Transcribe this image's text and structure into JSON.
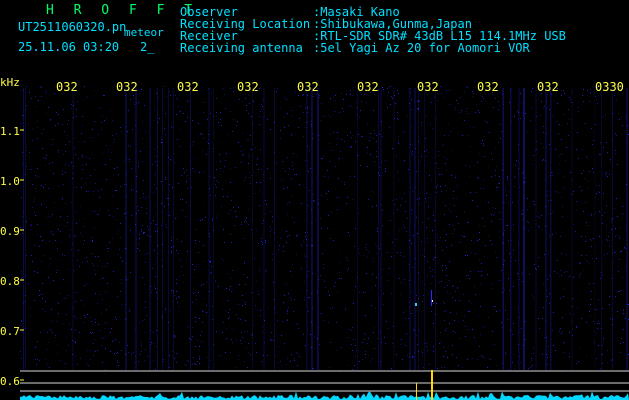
{
  "brand": "H R O F F T",
  "file_name": "UT2511060320.pn",
  "file_tag": "meteor",
  "timestamp": "25.11.06 03:20",
  "timestamp_suffix": "2_",
  "info": {
    "observer_key": "Observer",
    "observer_val": ":Masaki Kano",
    "location_key": "Receiving Location",
    "location_val": ":Shibukawa,Gunma,Japan",
    "receiver_key": "Receiver",
    "receiver_val": ":RTL-SDR SDR# 43dB L15 114.1MHz USB",
    "antenna_key": "Receiving antenna",
    "antenna_val": ":5el Yagi Az 20 for Aomori VOR"
  },
  "axis": {
    "unit": "kHz",
    "y_ticks": [
      "1.1",
      "1.0",
      "0.9",
      "0.8",
      "0.7",
      "0.6"
    ],
    "x_ticks": [
      "032",
      "032",
      "032",
      "032",
      "032",
      "032",
      "032",
      "032",
      "032",
      "0330"
    ]
  },
  "colors": {
    "background": "#000000",
    "text_cyan": "#00e0ff",
    "text_white": "#ffffff",
    "brand_green": "#00ff66",
    "axis_yellow": "#ffff44",
    "noise_blue": "#2a2aff",
    "spectrum": "#00d8ff"
  }
}
